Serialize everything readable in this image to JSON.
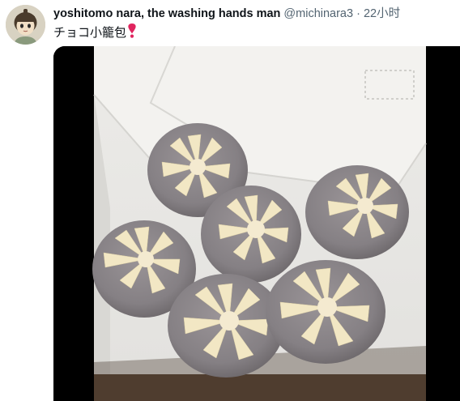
{
  "tweet": {
    "display_name": "yoshitomo nara, the washing hands man",
    "handle": "@michinara3",
    "separator": "·",
    "timestamp": "22小时",
    "text": "チョコ小籠包",
    "emoji": "heavy-red-heart-exclamation"
  },
  "media": {
    "kind": "video-frame",
    "subject": "chocolate xiaolongbao",
    "dumpling_count": 6
  },
  "colors": {
    "text_primary": "#0f1419",
    "text_secondary": "#536471",
    "media_background": "#000000",
    "heart": "#e0245e"
  }
}
